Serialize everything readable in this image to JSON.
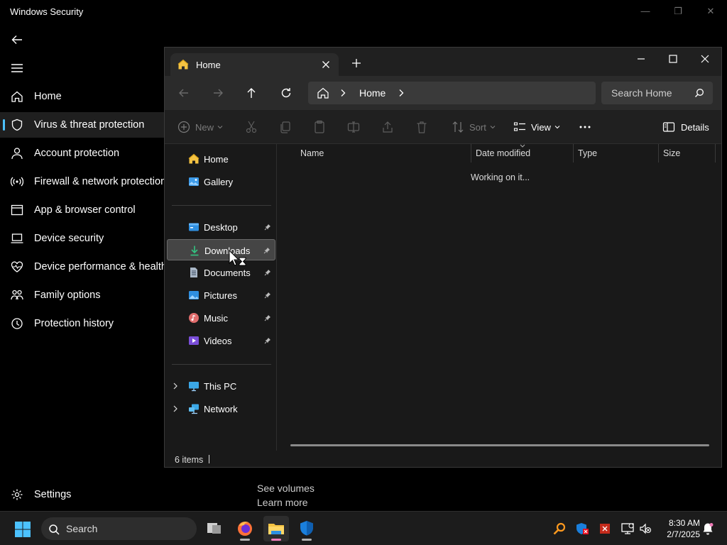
{
  "security_app": {
    "title": "Windows Security",
    "nav": [
      {
        "label": "Home",
        "icon": "home-icon"
      },
      {
        "label": "Virus & threat protection",
        "icon": "shield-icon",
        "active": true
      },
      {
        "label": "Account protection",
        "icon": "person-icon"
      },
      {
        "label": "Firewall & network protection",
        "icon": "wifi-icon"
      },
      {
        "label": "App & browser control",
        "icon": "app-window-icon"
      },
      {
        "label": "Device security",
        "icon": "laptop-icon"
      },
      {
        "label": "Device performance & health",
        "icon": "heart-icon"
      },
      {
        "label": "Family options",
        "icon": "family-icon"
      },
      {
        "label": "Protection history",
        "icon": "history-icon"
      }
    ],
    "settings_label": "Settings",
    "see_volumes": "See volumes",
    "learn_more": "Learn more"
  },
  "explorer": {
    "tab_label": "Home",
    "breadcrumb": "Home",
    "search_placeholder": "Search Home",
    "commands": {
      "new": "New",
      "sort": "Sort",
      "view": "View",
      "details": "Details"
    },
    "nav_top": [
      {
        "label": "Home",
        "icon": "home-icon"
      },
      {
        "label": "Gallery",
        "icon": "gallery-icon"
      }
    ],
    "nav_pinned": [
      {
        "label": "Desktop",
        "icon": "desktop-folder-icon"
      },
      {
        "label": "Downloads",
        "icon": "download-icon",
        "selected": true
      },
      {
        "label": "Documents",
        "icon": "document-icon"
      },
      {
        "label": "Pictures",
        "icon": "pictures-icon"
      },
      {
        "label": "Music",
        "icon": "music-icon"
      },
      {
        "label": "Videos",
        "icon": "video-icon"
      }
    ],
    "nav_bottom": [
      {
        "label": "This PC",
        "icon": "computer-icon"
      },
      {
        "label": "Network",
        "icon": "network-icon"
      }
    ],
    "columns": [
      "Name",
      "Date modified",
      "Type",
      "Size"
    ],
    "status_message": "Working on it...",
    "item_count": "6 items"
  },
  "taskbar": {
    "search_label": "Search",
    "time": "8:30 AM",
    "date": "2/7/2025"
  },
  "colors": {
    "accent": "#4cc2ff",
    "folder_yellow": "#f5c342",
    "active_underline": "#f07bb8"
  }
}
